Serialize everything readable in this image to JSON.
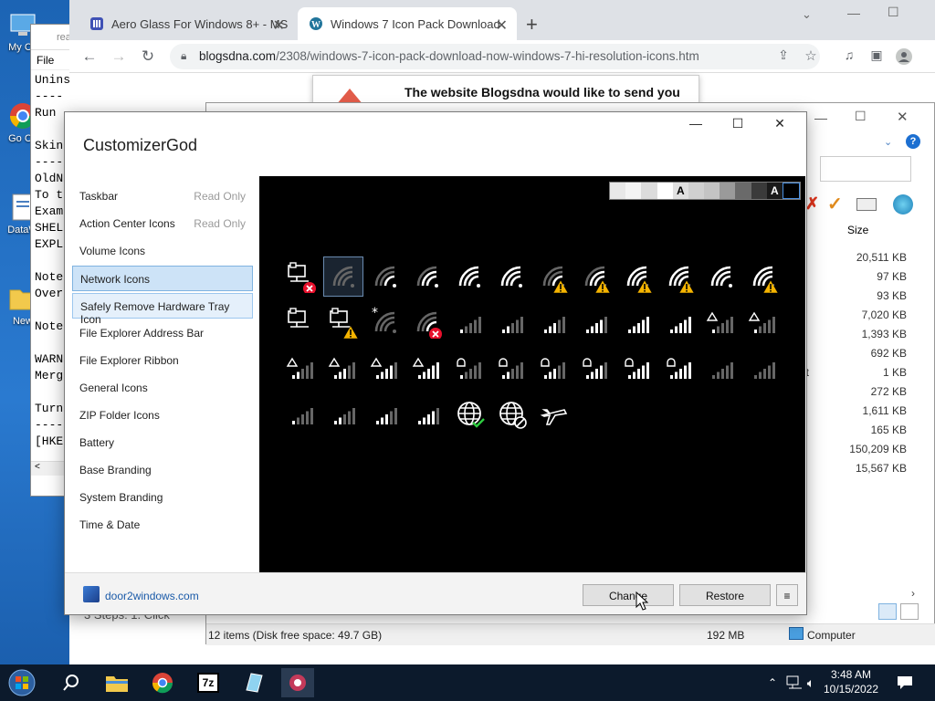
{
  "desktop": {
    "icons": [
      {
        "label": "My Co"
      },
      {
        "label": "Go Ch"
      },
      {
        "label": "DataW"
      },
      {
        "label": "New"
      }
    ]
  },
  "notepad": {
    "title": "rea",
    "menu_file": "File",
    "lines": [
      "",
      "Unins",
      "----",
      "Run",
      "",
      "Skin",
      "----",
      "OldN",
      "To t",
      "Exam",
      "SHEL",
      "EXPL",
      "",
      "Note",
      "Over",
      "",
      "Note",
      "",
      "WARN",
      "Merg",
      "",
      "Turn",
      "----",
      "[HKE"
    ]
  },
  "browser": {
    "tabs": [
      {
        "label": "Aero Glass For Windows 8+ - MS"
      },
      {
        "label": "Windows 7 Icon Pack Download"
      }
    ],
    "new_tab": "+",
    "url_host": "blogsdna.com",
    "url_path": "/2308/windows-7-icon-pack-download-now-windows-7-hi-resolution-icons.htm",
    "notification": "The website Blogsdna would like to send you"
  },
  "explorer": {
    "size_header": "Size",
    "sizes": [
      "20,511 KB",
      "97 KB",
      "93 KB",
      "7,020 KB",
      "1,393 KB",
      "692 KB",
      "1 KB",
      "272 KB",
      "1,611 KB",
      "165 KB",
      "150,209 KB",
      "15,567 KB"
    ],
    "side_text": "ut",
    "status_items": "12 items (Disk free space: 49.7 GB)",
    "status_size": "192 MB",
    "status_location": "Computer",
    "footer_text": "3 Steps: 1. Click \""
  },
  "cg": {
    "title": "CustomizerGod",
    "window_buttons": {
      "minimize": "—",
      "maximize": "☐",
      "close": "✕"
    },
    "sidebar": [
      {
        "label": "Taskbar",
        "note": "Read Only"
      },
      {
        "label": "Action Center Icons",
        "note": "Read Only"
      },
      {
        "label": "Volume Icons",
        "note": ""
      },
      {
        "label": "Network Icons",
        "note": ""
      },
      {
        "label": "Safely Remove Hardware Tray Icon",
        "note": ""
      },
      {
        "label": "File Explorer Address Bar",
        "note": ""
      },
      {
        "label": "File Explorer Ribbon",
        "note": ""
      },
      {
        "label": "General Icons",
        "note": ""
      },
      {
        "label": "ZIP Folder Icons",
        "note": ""
      },
      {
        "label": "Battery",
        "note": ""
      },
      {
        "label": "Base Branding",
        "note": ""
      },
      {
        "label": "System Branding",
        "note": ""
      },
      {
        "label": "Time & Date",
        "note": ""
      }
    ],
    "swatch_letter": "A",
    "footer_link": "door2windows.com",
    "change_label": "Change",
    "restore_label": "Restore",
    "menu_label": "≡"
  },
  "taskbar": {
    "time": "3:48 AM",
    "date": "10/15/2022",
    "app_7z": "7z"
  }
}
